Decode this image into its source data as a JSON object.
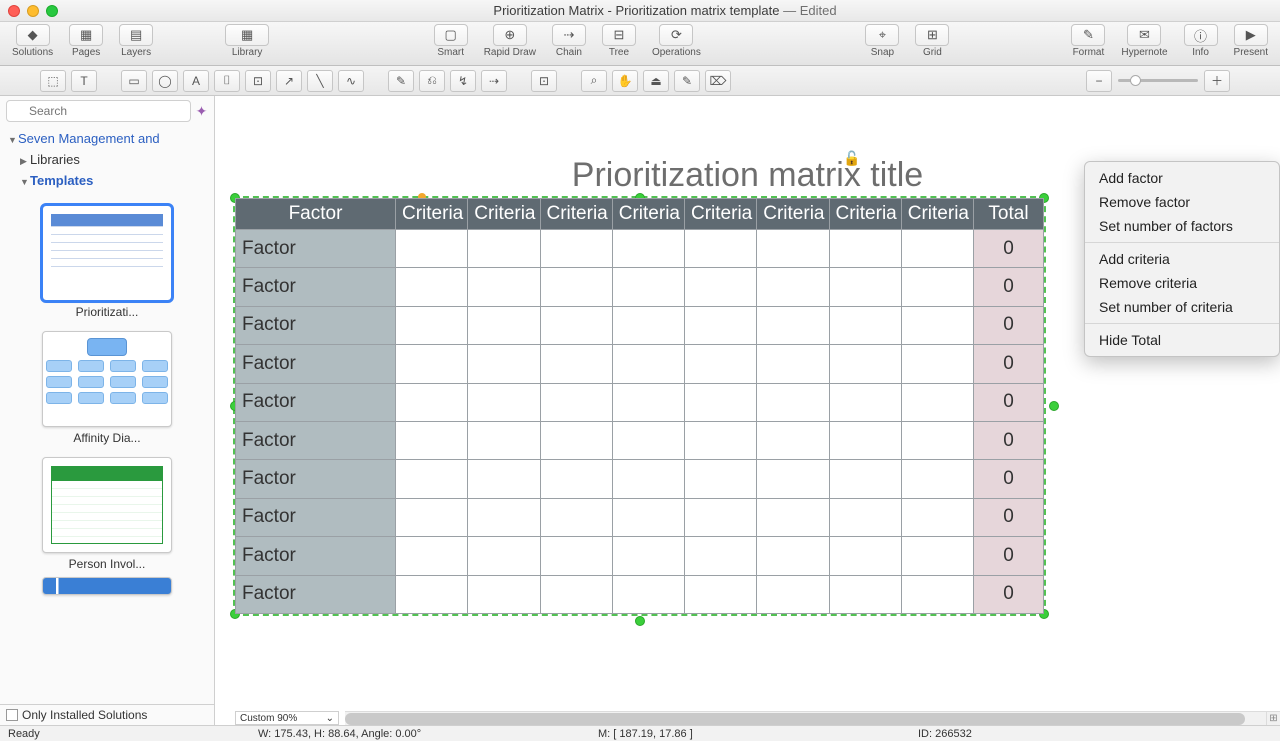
{
  "window": {
    "title_main": "Prioritization Matrix - Prioritization matrix template",
    "title_suffix": " — Edited"
  },
  "main_toolbar": {
    "left": [
      {
        "name": "solutions",
        "label": "Solutions",
        "icon": "◆"
      },
      {
        "name": "pages",
        "label": "Pages",
        "icon": "▦"
      },
      {
        "name": "layers",
        "label": "Layers",
        "icon": "▤"
      }
    ],
    "library": {
      "label": "Library",
      "icon": "▦"
    },
    "center": [
      {
        "name": "smart",
        "label": "Smart",
        "icon": "▢"
      },
      {
        "name": "rapiddraw",
        "label": "Rapid Draw",
        "icon": "⊕"
      },
      {
        "name": "chain",
        "label": "Chain",
        "icon": "⇢"
      },
      {
        "name": "tree",
        "label": "Tree",
        "icon": "⊟"
      },
      {
        "name": "operations",
        "label": "Operations",
        "icon": "⟳"
      }
    ],
    "view": [
      {
        "name": "snap",
        "label": "Snap",
        "icon": "⌖"
      },
      {
        "name": "grid",
        "label": "Grid",
        "icon": "⊞"
      }
    ],
    "right": [
      {
        "name": "format",
        "label": "Format",
        "icon": "✎"
      },
      {
        "name": "hypernote",
        "label": "Hypernote",
        "icon": "✉"
      },
      {
        "name": "info",
        "label": "Info",
        "icon": "ⓘ"
      },
      {
        "name": "present",
        "label": "Present",
        "icon": "▶"
      }
    ]
  },
  "toolstrip": {
    "tools": [
      "⬚",
      "T",
      "▭",
      "◯",
      "A",
      "⌷",
      "⊡",
      "↗",
      "╲",
      "∿",
      "✎",
      "⎌",
      "↯",
      "⇢",
      "⊡",
      "⌕",
      "✋",
      "⏏",
      "✎",
      "⌦"
    ],
    "zoom_out": "−",
    "zoom_in": "＋"
  },
  "sidebar": {
    "search_placeholder": "Search",
    "root": "Seven Management and",
    "libraries": "Libraries",
    "templates": "Templates",
    "thumbs": [
      {
        "label": "Prioritizati..."
      },
      {
        "label": "Affinity Dia..."
      },
      {
        "label": "Person Invol..."
      }
    ],
    "only_installed": "Only Installed Solutions"
  },
  "canvas": {
    "title": "Prioritization matrix title",
    "header_factor": "Factor",
    "header_criteria": "Criteria",
    "header_total": "Total",
    "criteria_count": 8,
    "rows": [
      {
        "factor": "Factor",
        "total": "0"
      },
      {
        "factor": "Factor",
        "total": "0"
      },
      {
        "factor": "Factor",
        "total": "0"
      },
      {
        "factor": "Factor",
        "total": "0"
      },
      {
        "factor": "Factor",
        "total": "0"
      },
      {
        "factor": "Factor",
        "total": "0"
      },
      {
        "factor": "Factor",
        "total": "0"
      },
      {
        "factor": "Factor",
        "total": "0"
      },
      {
        "factor": "Factor",
        "total": "0"
      },
      {
        "factor": "Factor",
        "total": "0"
      }
    ],
    "zoom_combo": "Custom 90%"
  },
  "context_menu": {
    "g1": [
      "Add factor",
      "Remove factor",
      "Set number of factors"
    ],
    "g2": [
      "Add criteria",
      "Remove criteria",
      "Set number of criteria"
    ],
    "g3": [
      "Hide Total"
    ]
  },
  "status": {
    "ready": "Ready",
    "dims": "W: 175.43,  H: 88.64,  Angle: 0.00°",
    "mouse": "M: [ 187.19, 17.86 ]",
    "id": "ID: 266532"
  }
}
